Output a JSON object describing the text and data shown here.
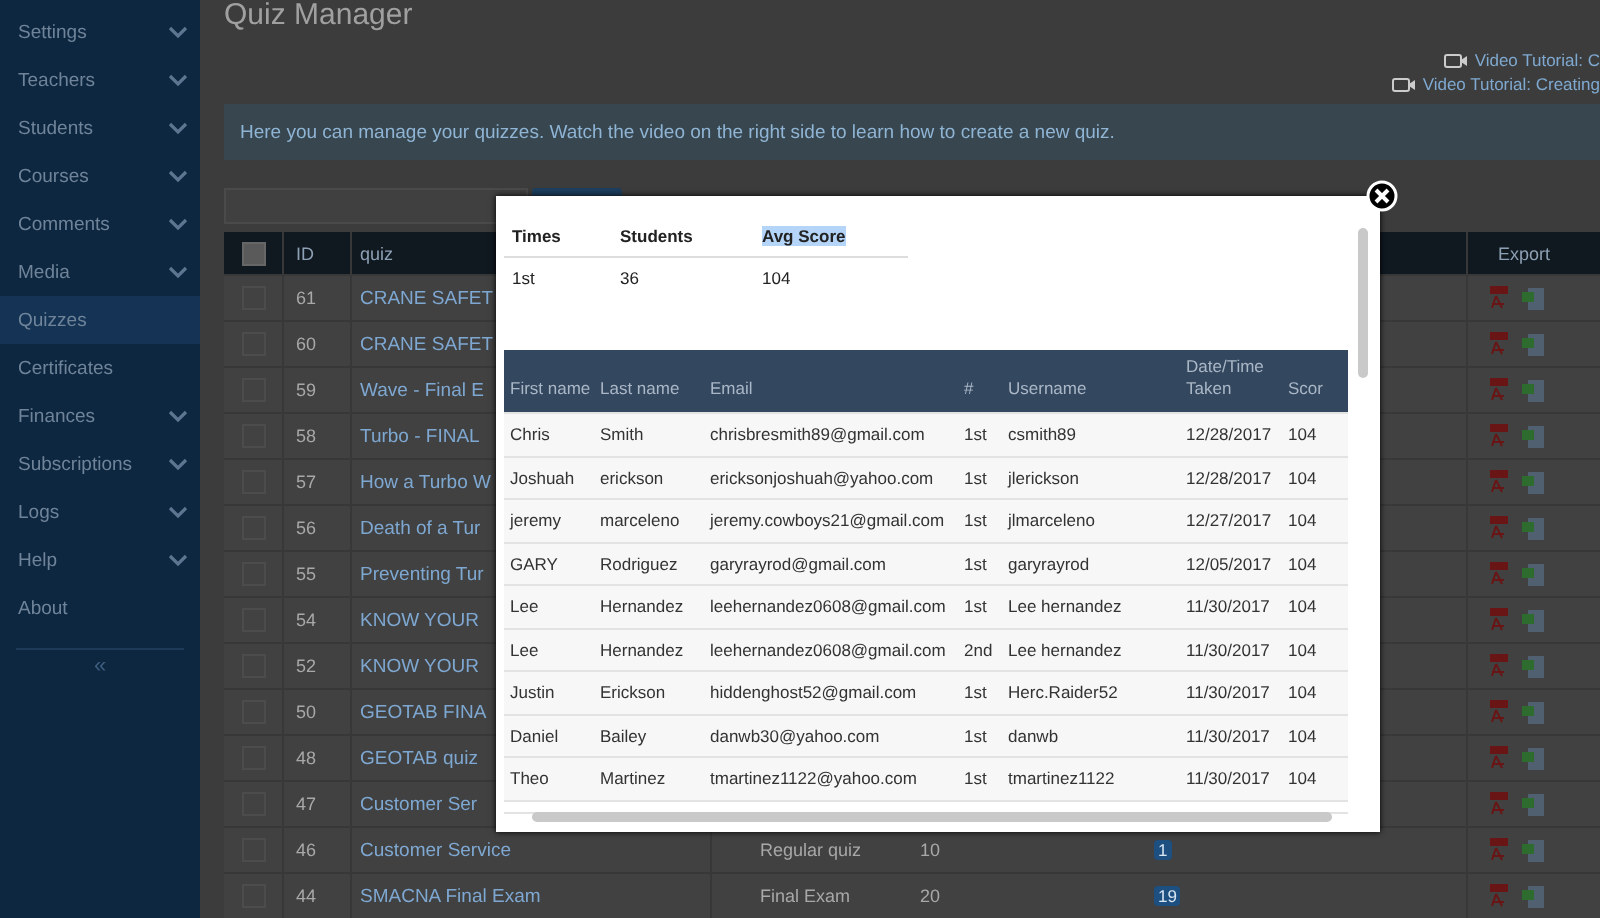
{
  "sidebar": {
    "items": [
      {
        "label": "Settings",
        "selected": false,
        "has_submenu": true
      },
      {
        "label": "Teachers",
        "selected": false,
        "has_submenu": true
      },
      {
        "label": "Students",
        "selected": false,
        "has_submenu": true
      },
      {
        "label": "Courses",
        "selected": false,
        "has_submenu": true
      },
      {
        "label": "Comments",
        "selected": false,
        "has_submenu": true
      },
      {
        "label": "Media",
        "selected": false,
        "has_submenu": true
      },
      {
        "label": "Quizzes",
        "selected": true,
        "has_submenu": false
      },
      {
        "label": "Certificates",
        "selected": false,
        "has_submenu": false
      },
      {
        "label": "Finances",
        "selected": false,
        "has_submenu": true
      },
      {
        "label": "Subscriptions",
        "selected": false,
        "has_submenu": true
      },
      {
        "label": "Logs",
        "selected": false,
        "has_submenu": true
      },
      {
        "label": "Help",
        "selected": false,
        "has_submenu": true
      },
      {
        "label": "About",
        "selected": false,
        "has_submenu": false
      }
    ],
    "collapse": "«"
  },
  "page": {
    "title": "Quiz Manager",
    "video_links": [
      "Video Tutorial: C",
      "Video Tutorial: Creating"
    ],
    "info": "Here you can manage your quizzes. Watch the video on the right side to learn how to create a new quiz."
  },
  "quiz_table": {
    "columns": [
      "ID",
      "quiz",
      "Export"
    ],
    "all_checked": false,
    "rows": [
      {
        "id": "61",
        "quiz": "CRANE SAFET",
        "checked": false
      },
      {
        "id": "60",
        "quiz": "CRANE SAFET",
        "checked": false
      },
      {
        "id": "59",
        "quiz": "Wave - Final E",
        "checked": false
      },
      {
        "id": "58",
        "quiz": "Turbo - FINAL",
        "checked": false
      },
      {
        "id": "57",
        "quiz": "How a Turbo W",
        "checked": false
      },
      {
        "id": "56",
        "quiz": "Death of a Tur",
        "checked": false
      },
      {
        "id": "55",
        "quiz": "Preventing Tur",
        "checked": false
      },
      {
        "id": "54",
        "quiz": "KNOW YOUR",
        "checked": false
      },
      {
        "id": "52",
        "quiz": "KNOW YOUR",
        "checked": false
      },
      {
        "id": "50",
        "quiz": "GEOTAB FINA",
        "checked": false
      },
      {
        "id": "48",
        "quiz": "GEOTAB quiz",
        "checked": false
      },
      {
        "id": "47",
        "quiz": "Customer Ser",
        "checked": false
      },
      {
        "id": "46",
        "quiz": "Customer Service",
        "checked": false,
        "type": "Regular quiz",
        "questions": "10",
        "count": "1"
      },
      {
        "id": "44",
        "quiz": "SMACNA Final Exam",
        "checked": false,
        "type": "Final Exam",
        "questions": "20",
        "count": "19"
      }
    ]
  },
  "modal": {
    "summary": {
      "columns": [
        {
          "label": "Times",
          "highlighted": false
        },
        {
          "label": "Students",
          "highlighted": false
        },
        {
          "label": "Avg Score",
          "highlighted": true
        }
      ],
      "row": [
        "1st",
        "36",
        "104"
      ]
    },
    "results": {
      "columns": [
        "First name",
        "Last name",
        "Email",
        "#",
        "Username",
        "Date/Time Taken",
        "Scor"
      ],
      "rows": [
        [
          "Chris",
          "Smith",
          "chrisbresmith89@gmail.com",
          "1st",
          "csmith89",
          "12/28/2017",
          "104"
        ],
        [
          "Joshuah",
          "erickson",
          "ericksonjoshuah@yahoo.com",
          "1st",
          "jlerickson",
          "12/28/2017",
          "104"
        ],
        [
          "jeremy",
          "marceleno",
          "jeremy.cowboys21@gmail.com",
          "1st",
          "jlmarceleno",
          "12/27/2017",
          "104"
        ],
        [
          "GARY",
          "Rodriguez",
          "garyrayrod@gmail.com",
          "1st",
          "garyrayrod",
          "12/05/2017",
          "104"
        ],
        [
          "Lee",
          "Hernandez",
          "leehernandez0608@gmail.com",
          "1st",
          "Lee hernandez",
          "11/30/2017",
          "104"
        ],
        [
          "Lee",
          "Hernandez",
          "leehernandez0608@gmail.com",
          "2nd",
          "Lee hernandez",
          "11/30/2017",
          "104"
        ],
        [
          "Justin",
          "Erickson",
          "hiddenghost52@gmail.com",
          "1st",
          "Herc.Raider52",
          "11/30/2017",
          "104"
        ],
        [
          "Daniel",
          "Bailey",
          "danwb30@yahoo.com",
          "1st",
          "danwb",
          "11/30/2017",
          "104"
        ],
        [
          "Theo",
          "Martinez",
          "tmartinez1122@yahoo.com",
          "1st",
          "tmartinez1122",
          "11/30/2017",
          "104"
        ]
      ]
    }
  }
}
